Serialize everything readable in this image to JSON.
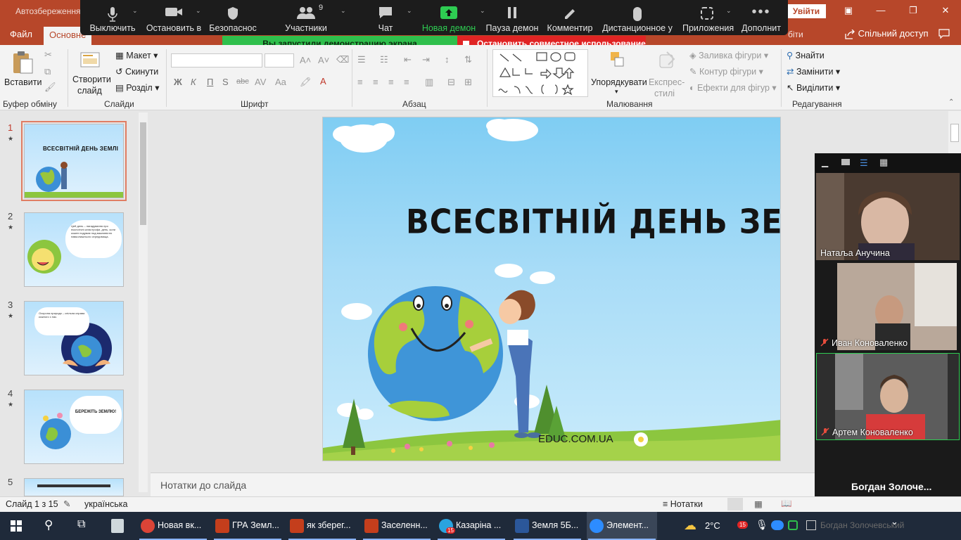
{
  "titlebar": {
    "autosave": "Автозбереження",
    "signin": "Увійти",
    "minimize": "—",
    "restore": "❐",
    "close": "✕",
    "ribbon_display": "▣"
  },
  "tabs": {
    "file": "Файл",
    "home": "Основне",
    "hint": "біти",
    "share": "Спільний доступ"
  },
  "zoom_toolbar": {
    "items": [
      "Выключить",
      "Остановить в",
      "Безопаснос",
      "Участники",
      "Чат",
      "Новая демон",
      "Пауза демон",
      "Комментир",
      "Дистанционное у",
      "Приложения",
      "Дополнит"
    ],
    "participants_count": "9"
  },
  "share_banner": {
    "sharing": "Вы запустили демонстрацию экрана",
    "stop": "Остановить совместное использование"
  },
  "ribbon": {
    "paste": "Вставити",
    "new_slide_line1": "Створити",
    "new_slide_line2": "слайд",
    "layout": "Макет",
    "reset": "Скинути",
    "section": "Розділ",
    "arrange": "Упорядкувати",
    "quick_styles_line1": "Експрес-",
    "quick_styles_line2": "стилі",
    "shape_fill": "Заливка фігури",
    "shape_outline": "Контур фігури",
    "shape_effects": "Ефекти для фігур",
    "find": "Знайти",
    "replace": "Замінити",
    "select": "Виділити",
    "bold": "Ж",
    "italic": "К",
    "underline": "П",
    "strike": "S",
    "groups": {
      "clipboard": "Буфер обміну",
      "slides": "Слайди",
      "font": "Шрифт",
      "paragraph": "Абзац",
      "drawing": "Малювання",
      "editing": "Редагування"
    }
  },
  "thumbnails": [
    {
      "num": "1",
      "star": "★",
      "title": "ВСЕСВІТНІЙ ДЕНЬ ЗЕМЛІ"
    },
    {
      "num": "2",
      "star": "★",
      "text": "Цей день – нагадування про екологічні катастрофи, день, коли кожен подумає над важливістю навколишнього середовища."
    },
    {
      "num": "3",
      "star": "★",
      "text": "Охорона природи – спільна справа кожного з нас."
    },
    {
      "num": "4",
      "star": "★",
      "text": "БЕРЕЖІТЬ ЗЕМЛЮ!"
    },
    {
      "num": "5",
      "star": "",
      "text": ""
    }
  ],
  "slide": {
    "title": "ВСЕСВІТНІЙ ДЕНЬ ЗЕМЛІ",
    "url": "EDUC.COM.UA"
  },
  "notes": {
    "placeholder": "Нотатки до слайда"
  },
  "status": {
    "slide_of": "Слайд 1 з 15",
    "language": "українська",
    "notes_button": "Нотатки"
  },
  "video_panel": {
    "participants": [
      {
        "name": "Натаља Анучина",
        "muted": false
      },
      {
        "name": "Иван Коноваленко",
        "muted": true
      },
      {
        "name": "Артем Коноваленко",
        "muted": true
      }
    ],
    "audio_only": {
      "name": "Богдан  Золоче...",
      "footer": "Богдан Золочевський"
    }
  },
  "taskbar": {
    "apps": [
      {
        "label": "Новая вк...",
        "color": "#db4437"
      },
      {
        "label": "ГРА Земл...",
        "color": "#c43e1c"
      },
      {
        "label": "як зберег...",
        "color": "#c43e1c"
      },
      {
        "label": "Заселенн...",
        "color": "#c43e1c"
      },
      {
        "label": "Казаріна ...",
        "color": "#2aa3df",
        "badge": "15"
      },
      {
        "label": "Земля 5Б...",
        "color": "#2b579a"
      },
      {
        "label": "Элемент...",
        "color": "#2d8cff"
      }
    ],
    "weather": "2°C",
    "tray_badge": "15"
  },
  "colors": {
    "ppt_red": "#b7472a",
    "zoom_green": "#2fbf4c",
    "zoom_red": "#e02424"
  }
}
